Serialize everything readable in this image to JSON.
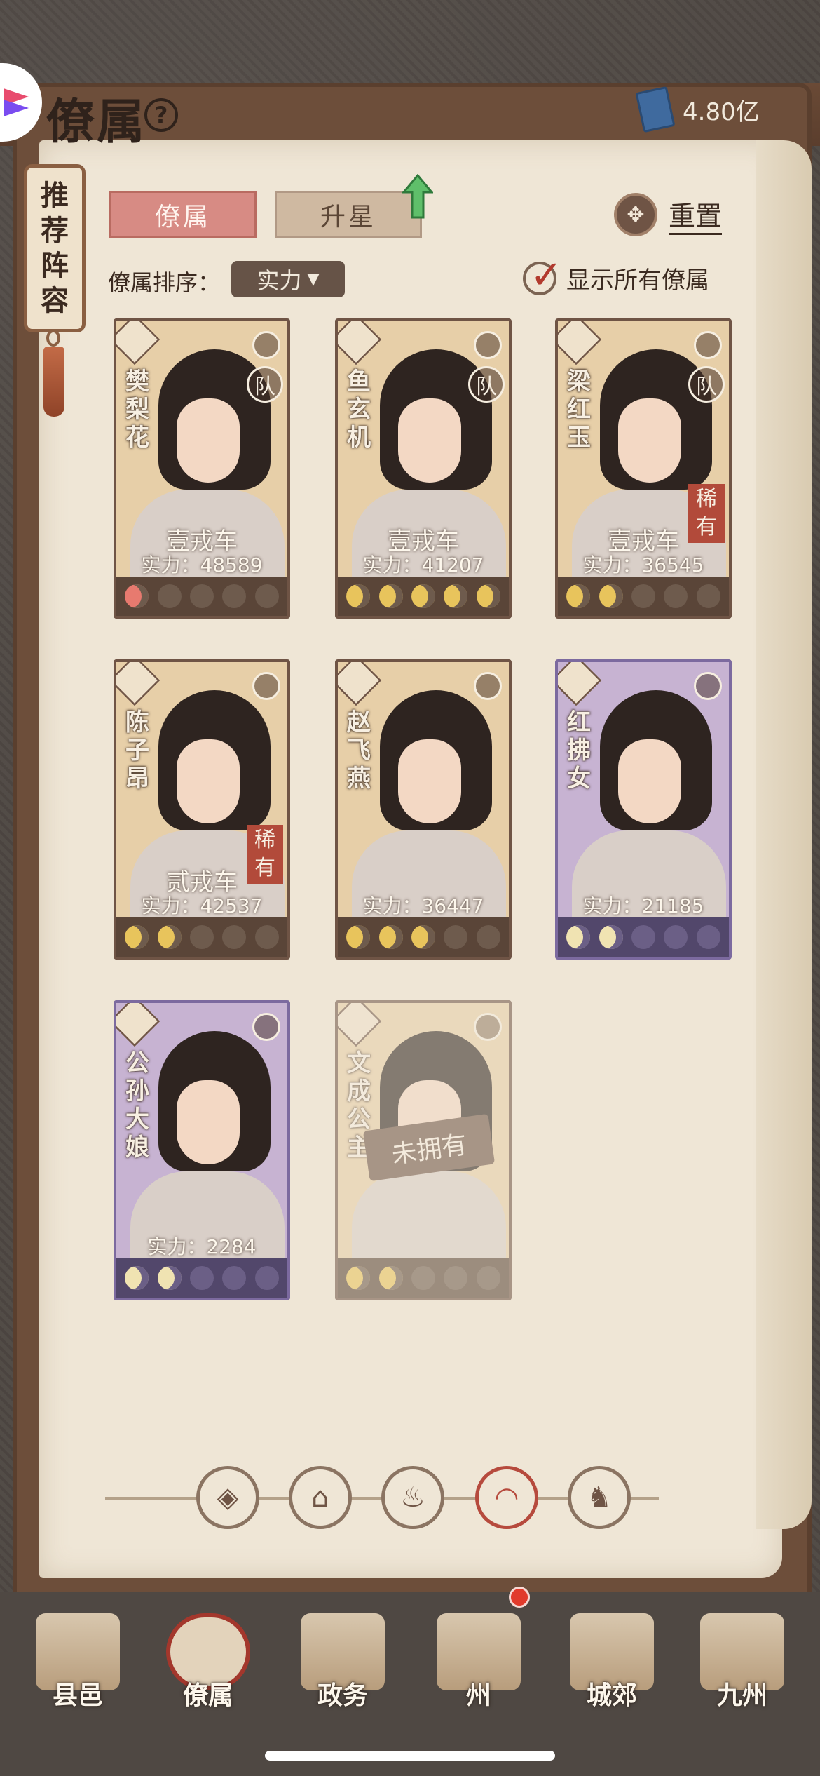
{
  "header": {
    "title": "僚属",
    "help_icon": "question-icon",
    "currency_value": "4.80亿"
  },
  "bookmark": {
    "chars": [
      "推",
      "荐",
      "阵",
      "容"
    ]
  },
  "tabs": [
    {
      "label": "僚属",
      "active": true
    },
    {
      "label": "升星",
      "active": false
    }
  ],
  "reset_label": "重置",
  "sort": {
    "label": "僚属排序：",
    "value": "实力"
  },
  "show_all": {
    "label": "显示所有僚属",
    "checked": true
  },
  "cards": [
    {
      "name": [
        "樊",
        "梨",
        "花"
      ],
      "rank": "壹戎车",
      "power": "实力：48589",
      "team": "队",
      "rare": false,
      "style": "tan",
      "moons_lit": 1,
      "moon_color": "red"
    },
    {
      "name": [
        "鱼",
        "玄",
        "机"
      ],
      "rank": "壹戎车",
      "power": "实力：41207",
      "team": "队",
      "rare": false,
      "style": "tan",
      "moons_lit": 5,
      "moon_color": "gold"
    },
    {
      "name": [
        "梁",
        "红",
        "玉"
      ],
      "rank": "壹戎车",
      "power": "实力：36545",
      "team": "队",
      "rare": true,
      "style": "tan",
      "moons_lit": 2,
      "moon_color": "gold"
    },
    {
      "name": [
        "陈",
        "子",
        "昂"
      ],
      "rank": "贰戎车",
      "power": "实力：42537",
      "team": "",
      "rare": true,
      "style": "tan",
      "moons_lit": 2,
      "moon_color": "gold"
    },
    {
      "name": [
        "赵",
        "飞",
        "燕"
      ],
      "rank": "",
      "power": "实力：36447",
      "team": "",
      "rare": false,
      "style": "tan",
      "moons_lit": 3,
      "moon_color": "gold"
    },
    {
      "name": [
        "红",
        "拂",
        "女"
      ],
      "rank": "",
      "power": "实力：21185",
      "team": "",
      "rare": false,
      "style": "purple",
      "moons_lit": 2,
      "moon_color": "gold"
    },
    {
      "name": [
        "公",
        "孙",
        "大",
        "娘"
      ],
      "rank": "",
      "power": "实力：2284",
      "team": "",
      "rare": false,
      "style": "purple",
      "moons_lit": 2,
      "moon_color": "gold"
    },
    {
      "name": [
        "文",
        "成",
        "公",
        "主"
      ],
      "rank": "",
      "power": "",
      "team": "",
      "rare": false,
      "style": "dim",
      "moons_lit": 2,
      "moon_color": "gold",
      "unowned": "未拥有"
    }
  ],
  "rare_label": [
    "稀",
    "有"
  ],
  "category_icons": [
    "diamond-icon",
    "hat-icon",
    "vase-icon",
    "fan-icon",
    "lion-icon"
  ],
  "bottom_nav": [
    {
      "label": "县邑",
      "active": false
    },
    {
      "label": "僚属",
      "active": true
    },
    {
      "label": "政务",
      "active": false
    },
    {
      "label": "州",
      "active": false
    },
    {
      "label": "城郊",
      "active": false
    },
    {
      "label": "九州",
      "active": false
    }
  ]
}
